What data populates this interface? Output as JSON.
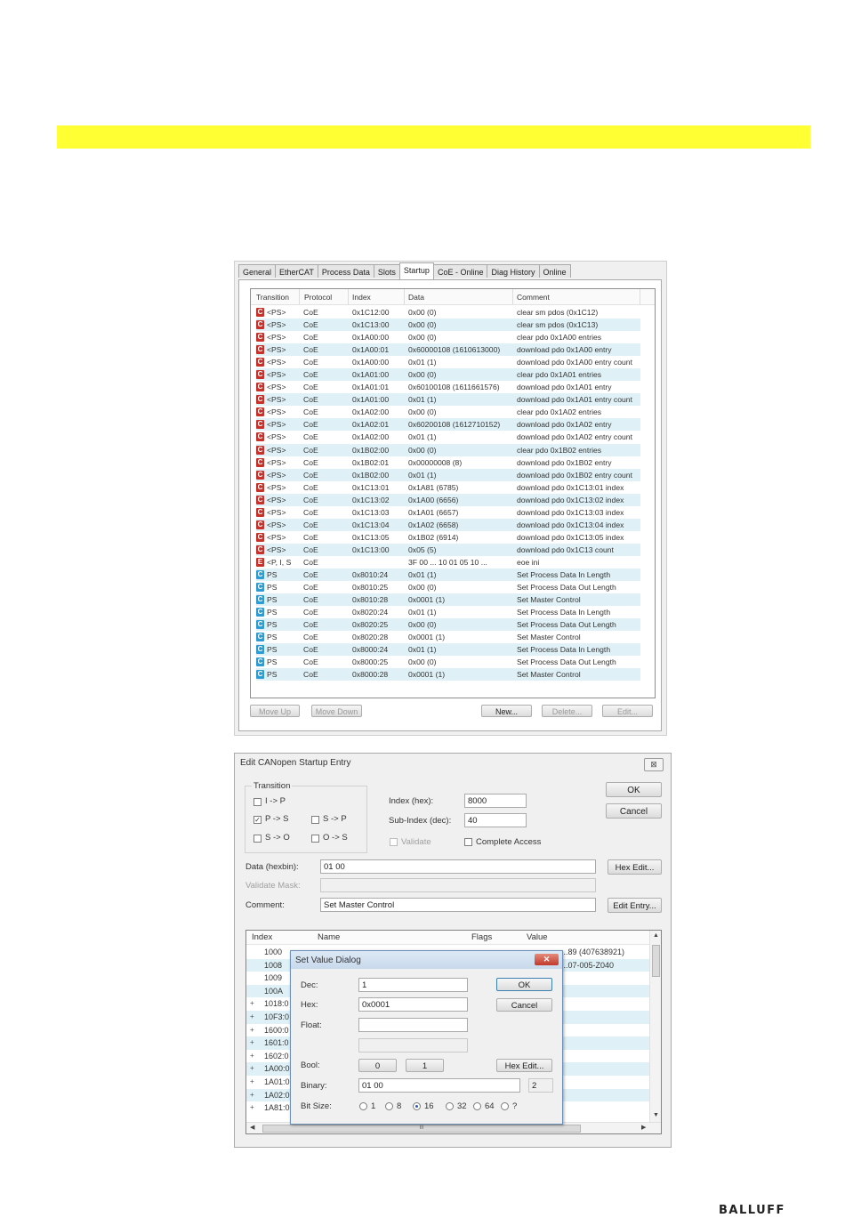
{
  "startup": {
    "tabs": [
      "General",
      "EtherCAT",
      "Process Data",
      "Slots",
      "Startup",
      "CoE - Online",
      "Diag History",
      "Online"
    ],
    "active_tab": "Startup",
    "columns": [
      "Transition",
      "Protocol",
      "Index",
      "Data",
      "Comment"
    ],
    "rows": [
      {
        "icon": "C",
        "color": "red",
        "t": "<PS>",
        "p": "CoE",
        "i": "0x1C12:00",
        "d": "0x00 (0)",
        "c": "clear sm pdos (0x1C12)"
      },
      {
        "icon": "C",
        "color": "red",
        "t": "<PS>",
        "p": "CoE",
        "i": "0x1C13:00",
        "d": "0x00 (0)",
        "c": "clear sm pdos (0x1C13)"
      },
      {
        "icon": "C",
        "color": "red",
        "t": "<PS>",
        "p": "CoE",
        "i": "0x1A00:00",
        "d": "0x00 (0)",
        "c": "clear pdo 0x1A00 entries"
      },
      {
        "icon": "C",
        "color": "red",
        "t": "<PS>",
        "p": "CoE",
        "i": "0x1A00:01",
        "d": "0x60000108 (1610613000)",
        "c": "download pdo 0x1A00 entry"
      },
      {
        "icon": "C",
        "color": "red",
        "t": "<PS>",
        "p": "CoE",
        "i": "0x1A00:00",
        "d": "0x01 (1)",
        "c": "download pdo 0x1A00 entry count"
      },
      {
        "icon": "C",
        "color": "red",
        "t": "<PS>",
        "p": "CoE",
        "i": "0x1A01:00",
        "d": "0x00 (0)",
        "c": "clear pdo 0x1A01 entries"
      },
      {
        "icon": "C",
        "color": "red",
        "t": "<PS>",
        "p": "CoE",
        "i": "0x1A01:01",
        "d": "0x60100108 (1611661576)",
        "c": "download pdo 0x1A01 entry"
      },
      {
        "icon": "C",
        "color": "red",
        "t": "<PS>",
        "p": "CoE",
        "i": "0x1A01:00",
        "d": "0x01 (1)",
        "c": "download pdo 0x1A01 entry count"
      },
      {
        "icon": "C",
        "color": "red",
        "t": "<PS>",
        "p": "CoE",
        "i": "0x1A02:00",
        "d": "0x00 (0)",
        "c": "clear pdo 0x1A02 entries"
      },
      {
        "icon": "C",
        "color": "red",
        "t": "<PS>",
        "p": "CoE",
        "i": "0x1A02:01",
        "d": "0x60200108 (1612710152)",
        "c": "download pdo 0x1A02 entry"
      },
      {
        "icon": "C",
        "color": "red",
        "t": "<PS>",
        "p": "CoE",
        "i": "0x1A02:00",
        "d": "0x01 (1)",
        "c": "download pdo 0x1A02 entry count"
      },
      {
        "icon": "C",
        "color": "red",
        "t": "<PS>",
        "p": "CoE",
        "i": "0x1B02:00",
        "d": "0x00 (0)",
        "c": "clear pdo 0x1B02 entries"
      },
      {
        "icon": "C",
        "color": "red",
        "t": "<PS>",
        "p": "CoE",
        "i": "0x1B02:01",
        "d": "0x00000008 (8)",
        "c": "download pdo 0x1B02 entry"
      },
      {
        "icon": "C",
        "color": "red",
        "t": "<PS>",
        "p": "CoE",
        "i": "0x1B02:00",
        "d": "0x01 (1)",
        "c": "download pdo 0x1B02 entry count"
      },
      {
        "icon": "C",
        "color": "red",
        "t": "<PS>",
        "p": "CoE",
        "i": "0x1C13:01",
        "d": "0x1A81 (6785)",
        "c": "download pdo 0x1C13:01 index"
      },
      {
        "icon": "C",
        "color": "red",
        "t": "<PS>",
        "p": "CoE",
        "i": "0x1C13:02",
        "d": "0x1A00 (6656)",
        "c": "download pdo 0x1C13:02 index"
      },
      {
        "icon": "C",
        "color": "red",
        "t": "<PS>",
        "p": "CoE",
        "i": "0x1C13:03",
        "d": "0x1A01 (6657)",
        "c": "download pdo 0x1C13:03 index"
      },
      {
        "icon": "C",
        "color": "red",
        "t": "<PS>",
        "p": "CoE",
        "i": "0x1C13:04",
        "d": "0x1A02 (6658)",
        "c": "download pdo 0x1C13:04 index"
      },
      {
        "icon": "C",
        "color": "red",
        "t": "<PS>",
        "p": "CoE",
        "i": "0x1C13:05",
        "d": "0x1B02 (6914)",
        "c": "download pdo 0x1C13:05 index"
      },
      {
        "icon": "C",
        "color": "red",
        "t": "<PS>",
        "p": "CoE",
        "i": "0x1C13:00",
        "d": "0x05 (5)",
        "c": "download pdo 0x1C13 count"
      },
      {
        "icon": "E",
        "color": "red",
        "t": "<P, I, S",
        "p": "CoE",
        "i": "",
        "d": "3F 00 ... 10 01 05 10 ...",
        "c": "eoe ini"
      },
      {
        "icon": "C",
        "color": "blue",
        "t": "PS",
        "p": "CoE",
        "i": "0x8010:24",
        "d": "0x01 (1)",
        "c": "Set Process Data In Length"
      },
      {
        "icon": "C",
        "color": "blue",
        "t": "PS",
        "p": "CoE",
        "i": "0x8010:25",
        "d": "0x00 (0)",
        "c": "Set Process Data Out Length"
      },
      {
        "icon": "C",
        "color": "blue",
        "t": "PS",
        "p": "CoE",
        "i": "0x8010:28",
        "d": "0x0001 (1)",
        "c": "Set Master Control"
      },
      {
        "icon": "C",
        "color": "blue",
        "t": "PS",
        "p": "CoE",
        "i": "0x8020:24",
        "d": "0x01 (1)",
        "c": "Set Process Data In Length"
      },
      {
        "icon": "C",
        "color": "blue",
        "t": "PS",
        "p": "CoE",
        "i": "0x8020:25",
        "d": "0x00 (0)",
        "c": "Set Process Data Out Length"
      },
      {
        "icon": "C",
        "color": "blue",
        "t": "PS",
        "p": "CoE",
        "i": "0x8020:28",
        "d": "0x0001 (1)",
        "c": "Set Master Control"
      },
      {
        "icon": "C",
        "color": "blue",
        "t": "PS",
        "p": "CoE",
        "i": "0x8000:24",
        "d": "0x01 (1)",
        "c": "Set Process Data In Length"
      },
      {
        "icon": "C",
        "color": "blue",
        "t": "PS",
        "p": "CoE",
        "i": "0x8000:25",
        "d": "0x00 (0)",
        "c": "Set Process Data Out Length"
      },
      {
        "icon": "C",
        "color": "blue",
        "t": "PS",
        "p": "CoE",
        "i": "0x8000:28",
        "d": "0x0001 (1)",
        "c": "Set Master Control"
      }
    ],
    "buttons": {
      "move_up": "Move Up",
      "move_down": "Move Down",
      "new": "New...",
      "delete": "Delete...",
      "edit": "Edit..."
    }
  },
  "edit_dialog": {
    "title": "Edit CANopen Startup Entry",
    "close_glyph": "⊠",
    "transition_label": "Transition",
    "ip": "I -> P",
    "ps": "P -> S",
    "sp": "S -> P",
    "so": "S -> O",
    "os": "O -> S",
    "ps_check": "✓",
    "index_label": "Index (hex):",
    "index_value": "8000",
    "subindex_label": "Sub-Index (dec):",
    "subindex_value": "40",
    "validate_label": "Validate",
    "complete_access_label": "Complete Access",
    "ok": "OK",
    "cancel": "Cancel",
    "data_label": "Data (hexbin):",
    "data_value": "01 00",
    "hex_edit": "Hex Edit...",
    "validate_mask_label": "Validate Mask:",
    "comment_label": "Comment:",
    "comment_value": "Set Master Control",
    "edit_entry": "Edit Entry...",
    "tree_columns": [
      "Index",
      "Name",
      "Flags",
      "Value"
    ],
    "tree_rows": [
      {
        "exp": "",
        "name": "1000",
        "value": "...89 (407638921)"
      },
      {
        "exp": "",
        "name": "1008",
        "value": "...07-005-Z040"
      },
      {
        "exp": "",
        "name": "1009",
        "value": ""
      },
      {
        "exp": "",
        "name": "100A",
        "value": ""
      },
      {
        "exp": "+",
        "name": "1018:0",
        "value": ""
      },
      {
        "exp": "+",
        "name": "10F3:0",
        "value": ""
      },
      {
        "exp": "+",
        "name": "1600:0",
        "value": ""
      },
      {
        "exp": "+",
        "name": "1601:0",
        "value": ""
      },
      {
        "exp": "+",
        "name": "1602:0",
        "value": ""
      },
      {
        "exp": "+",
        "name": "1A00:0",
        "value": ""
      },
      {
        "exp": "+",
        "name": "1A01:0",
        "value": ""
      },
      {
        "exp": "+",
        "name": "1A02:0",
        "value": ""
      },
      {
        "exp": "+",
        "name": "1A81:0",
        "value": ""
      }
    ],
    "scroll_thumb_glyph": "III"
  },
  "set_value_dialog": {
    "title": "Set Value Dialog",
    "close_glyph": "✕",
    "dec_label": "Dec:",
    "dec_value": "1",
    "hex_label": "Hex:",
    "hex_value": "0x0001",
    "float_label": "Float:",
    "float_value": "",
    "bool_label": "Bool:",
    "bool_0": "0",
    "bool_1": "1",
    "binary_label": "Binary:",
    "binary_value": "01 00",
    "binary_len": "2",
    "bitsize_label": "Bit Size:",
    "bitsizes": [
      "1",
      "8",
      "16",
      "32",
      "64",
      "?"
    ],
    "bitsize_selected": "16",
    "ok": "OK",
    "cancel": "Cancel",
    "hex_edit": "Hex Edit..."
  },
  "brand": {
    "logo_text": "BALLUFF"
  },
  "colors": {
    "highlight_bar": "#ffff33",
    "row_alt": "#dff1f6",
    "icon_red": "#c8302a",
    "icon_blue": "#2e9bd3"
  }
}
